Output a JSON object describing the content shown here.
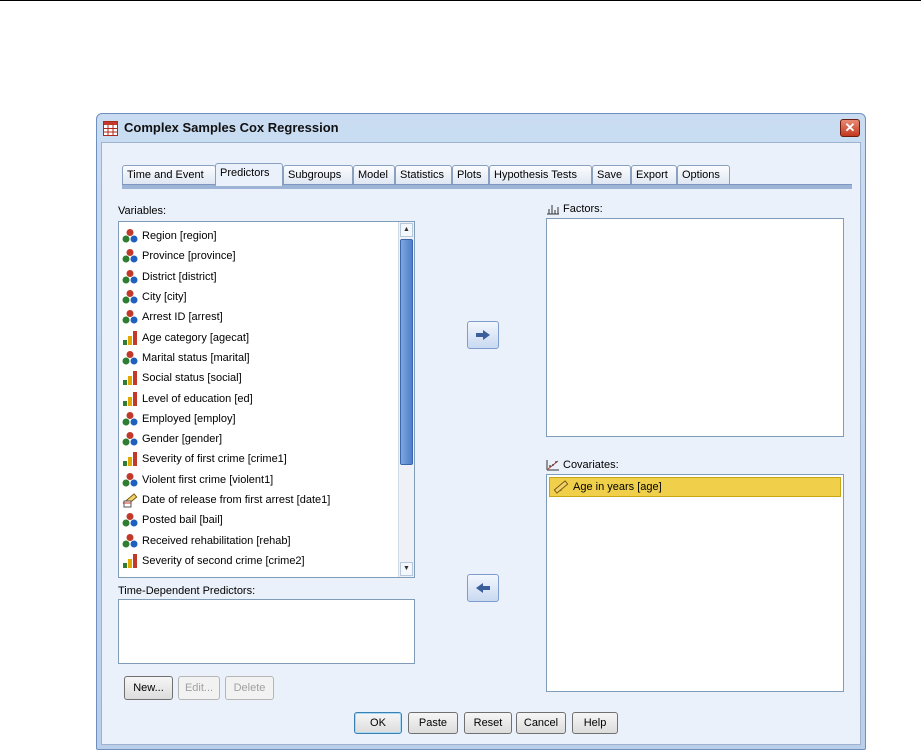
{
  "dialog": {
    "title": "Complex Samples Cox Regression",
    "close_label": "✕"
  },
  "tabs": [
    {
      "label": "Time and Event"
    },
    {
      "label": "Predictors"
    },
    {
      "label": "Subgroups"
    },
    {
      "label": "Model"
    },
    {
      "label": "Statistics"
    },
    {
      "label": "Plots"
    },
    {
      "label": "Hypothesis Tests"
    },
    {
      "label": "Save"
    },
    {
      "label": "Export"
    },
    {
      "label": "Options"
    }
  ],
  "active_tab": "Predictors",
  "variables": {
    "label": "Variables:",
    "items": [
      {
        "label": "Region [region]",
        "icon": "nominal-icon"
      },
      {
        "label": "Province [province]",
        "icon": "nominal-icon"
      },
      {
        "label": "District [district]",
        "icon": "nominal-icon"
      },
      {
        "label": "City [city]",
        "icon": "nominal-icon"
      },
      {
        "label": "Arrest ID [arrest]",
        "icon": "nominal-icon"
      },
      {
        "label": "Age category [agecat]",
        "icon": "ordinal-icon"
      },
      {
        "label": "Marital status [marital]",
        "icon": "nominal-icon"
      },
      {
        "label": "Social status [social]",
        "icon": "ordinal-icon"
      },
      {
        "label": "Level of education [ed]",
        "icon": "ordinal-icon"
      },
      {
        "label": "Employed [employ]",
        "icon": "nominal-icon"
      },
      {
        "label": "Gender [gender]",
        "icon": "nominal-icon"
      },
      {
        "label": "Severity of first crime [crime1]",
        "icon": "ordinal-icon"
      },
      {
        "label": "Violent first crime [violent1]",
        "icon": "nominal-icon"
      },
      {
        "label": "Date of release from first arrest [date1]",
        "icon": "scale-date-icon"
      },
      {
        "label": "Posted bail [bail]",
        "icon": "nominal-icon"
      },
      {
        "label": "Received rehabilitation [rehab]",
        "icon": "nominal-icon"
      },
      {
        "label": "Severity of second crime [crime2]",
        "icon": "ordinal-icon"
      }
    ]
  },
  "time_dependent": {
    "label": "Time-Dependent Predictors:",
    "new_label": "New...",
    "edit_label": "Edit...",
    "delete_label": "Delete"
  },
  "factors": {
    "label": "Factors:",
    "mnemonic": "F",
    "icon": "factors-icon"
  },
  "covariates": {
    "label": "Covariates:",
    "mnemonic": "C",
    "icon": "covariates-icon",
    "items": [
      {
        "label": "Age in years [age]",
        "icon": "scale-icon",
        "selected": true
      }
    ]
  },
  "buttons": {
    "ok": "OK",
    "paste": "Paste",
    "reset": "Reset",
    "cancel": "Cancel",
    "help": "Help"
  },
  "colors": {
    "selected_row": "#f0d04a",
    "title_bar": "#c9dcf2",
    "close_button": "#c2391f"
  }
}
